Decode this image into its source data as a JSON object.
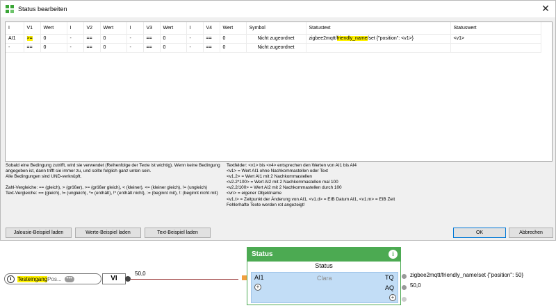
{
  "dialog": {
    "title": "Status bearbeiten",
    "close_glyph": "✕",
    "table": {
      "headers": [
        "I",
        "V1",
        "Wert",
        "I",
        "V2",
        "Wert",
        "I",
        "V3",
        "Wert",
        "I",
        "V4",
        "Wert",
        "Symbol",
        "Statustext",
        "Statuswert"
      ],
      "rows": [
        {
          "i1": "AI1",
          "v1": ">=",
          "w1": "0",
          "i2": "-",
          "v2": "==",
          "w2": "0",
          "i3": "-",
          "v3": "==",
          "w3": "0",
          "i4": "-",
          "v4": "==",
          "w4": "0",
          "symbol": "Nicht zugeordnet",
          "text_a": "zigbee2mqtt/",
          "text_b": "friendly_name",
          "text_c": "/set {\"position\": <v1>}",
          "statuswert": "<v1>"
        },
        {
          "i1": "-",
          "v1": "==",
          "w1": "0",
          "i2": "-",
          "v2": "==",
          "w2": "0",
          "i3": "-",
          "v3": "==",
          "w3": "0",
          "i4": "-",
          "v4": "==",
          "w4": "0",
          "symbol": "Nicht zugeordnet",
          "text_a": "",
          "text_b": "",
          "text_c": "",
          "statuswert": ""
        }
      ]
    },
    "help_left": "Sobald eine Bedingung zutrifft, wird sie verwendet (Reihenfolge der Texte ist wichtig). Wenn keine Bedingung angegeben ist, dann trifft sie immer zu, und sollte folglich ganz unten sein.\nAlle Bedingungen sind UND-verknüpft.\n\nZahl-Vergleiche: == (gleich), > (größer), >= (größer gleich), < (kleiner), <= (kleiner gleich), != (ungleich)\nText-Vergleiche: == (gleich), != (ungleich), *= (enthält), !* (enthält nicht), := (beginnt mit), !: (beginnt nicht mit)",
    "help_right": "Textfelder: <v1> bis <v4> entsprechen den Werten von AI1 bis AI4\n<v1> = Wert AI1 ohne Nachkommastellen oder Text\n<v1.2> = Wert AI1 mit 2 Nachkommastellen\n<v2.2*100> = Wert AI2 mit 2 Nachkommastellen mal 100\n<v2.2/100> = Wert AI2 mit 2 Nachkommastellen durch 100\n<vn> = eigener Objektname\n<v1.t> = Zeitpunkt der Änderung von AI1, <v1.d> = EIB Datum AI1, <v1.m> = EIB Zeit\nFehlerhafte Texte werden rot angezeigt!",
    "buttons": {
      "jalousie": "Jalousie-Beispiel laden",
      "werte": "Werte-Beispiel laden",
      "text": "Text-Beispiel laden",
      "ok": "OK",
      "cancel": "Abbrechen"
    }
  },
  "canvas": {
    "input_node": {
      "label_highlight": "Testeingang",
      "label_rest": " Pos...",
      "dots": "•••",
      "type": "VI",
      "info": "i"
    },
    "wire_value": "50,0",
    "status_block": {
      "header": "Status",
      "info": "i",
      "subtitle": "Status",
      "input_label": "AI1",
      "name": "Clara",
      "out1_label": "TQ",
      "out2_label": "AQ",
      "plus": "+"
    },
    "outputs": {
      "tq_value": "zigbee2mqtt/friendly_name/set {\"position\": 50}",
      "aq_value": "50,0"
    }
  },
  "colors": {
    "highlight": "#fff200",
    "block_green": "#4caa52",
    "block_body": "#c2ddf6",
    "wire": "#8b1a1a"
  }
}
